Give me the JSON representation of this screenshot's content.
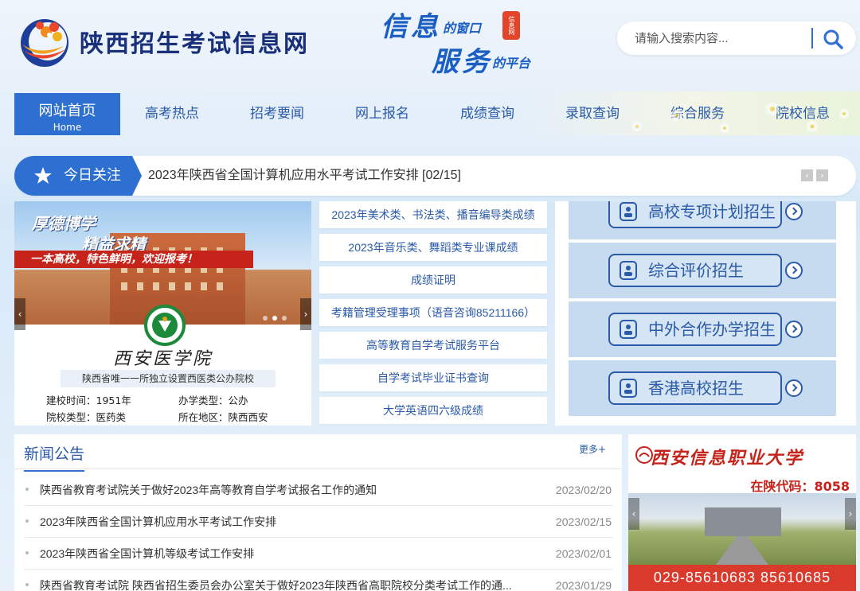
{
  "header": {
    "site_name": "陕西招生考试信息网",
    "slogan_line1_big": "信息",
    "slogan_line1_small": "的窗口",
    "slogan_line2_big": "服务",
    "slogan_line2_small": "的平台",
    "slogan_stamp": "信息网"
  },
  "search": {
    "placeholder": "请输入搜索内容..."
  },
  "nav": {
    "home_label": "网站首页",
    "home_sub": "Home",
    "items": [
      "高考热点",
      "招考要闻",
      "网上报名",
      "成绩查询",
      "录取查询",
      "综合服务",
      "院校信息"
    ]
  },
  "ticker": {
    "label": "今日关注",
    "text": "2023年陕西省全国计算机应用水平考试工作安排  [02/15]"
  },
  "banner": {
    "slogan1": "厚德博学",
    "slogan2": "精益求精",
    "slogan3": "一本高校，特色鲜明，欢迎报考！",
    "school_name": "西安医学院",
    "school_tag": "陕西省唯一一所独立设置西医类公办院校",
    "founded": "建校时间：1951年",
    "run_type": "办学类型：公办",
    "school_type": "院校类型：医药类",
    "location": "所在地区：陕西西安"
  },
  "mid_links": [
    "2023年美术类、书法类、播音编导类成绩",
    "2023年音乐类、舞蹈类专业课成绩",
    "成绩证明",
    "考籍管理受理事项（语音咨询85211166）",
    "高等教育自学考试服务平台",
    "自学考试毕业证书查询",
    "大学英语四六级成绩"
  ],
  "admissions": [
    "高校专项计划招生",
    "综合评价招生",
    "中外合作办学招生",
    "香港高校招生"
  ],
  "news": {
    "title": "新闻公告",
    "more": "更多+",
    "items": [
      {
        "text": "陕西省教育考试院关于做好2023年高等教育自学考试报名工作的通知",
        "date": "2023/02/20"
      },
      {
        "text": "2023年陕西省全国计算机应用水平考试工作安排",
        "date": "2023/02/15"
      },
      {
        "text": "2023年陕西省全国计算机等级考试工作安排",
        "date": "2023/02/01"
      },
      {
        "text": "陕西省教育考试院 陕西省招生委员会办公室关于做好2023年陕西省高职院校分类考试工作的通...",
        "date": "2023/01/29"
      }
    ]
  },
  "ad": {
    "title": "西安信息职业大学",
    "code": "在陕代码：8058",
    "phone": "029-85610683  85610685"
  },
  "colors": {
    "primary": "#2e6fd2",
    "link": "#2a5aa8",
    "accent_red": "#d93a2b"
  }
}
